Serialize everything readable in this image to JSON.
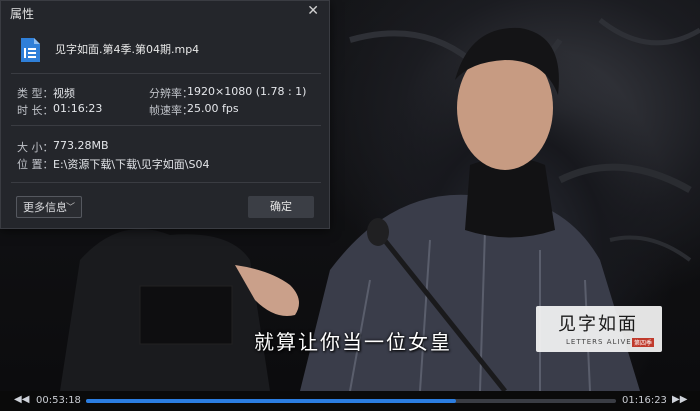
{
  "video": {
    "subtitle": "就算让你当一位女皇",
    "logo_text": "见字如面",
    "logo_en": "LETTERS ALIVE",
    "logo_tag": "第四季"
  },
  "player": {
    "elapsed": "00:53:18",
    "total": "01:16:23",
    "progress": 0.698,
    "prev_icon": "rewind-icon",
    "next_icon": "fast-forward-icon",
    "accent": "#2b7de0"
  },
  "dialog": {
    "title": "属性",
    "close_icon": "close-icon",
    "file_icon": "video-file-icon",
    "file_name": "见字如面.第4季.第04期.mp4",
    "type_label": "类 型：",
    "type_value": "视频",
    "duration_label": "时 长：",
    "duration_value": "01:16:23",
    "resolution_label": "分辨率：",
    "resolution_value": "1920×1080 (1.78 : 1)",
    "framerate_label": "帧速率：",
    "framerate_value": "25.00 fps",
    "size_label": "大 小：",
    "size_value": "773.28MB",
    "location_label": "位 置：",
    "location_value": "E:\\资源下载\\下载\\见字如面\\S04",
    "more_info_label": "更多信息",
    "ok_label": "确定"
  }
}
